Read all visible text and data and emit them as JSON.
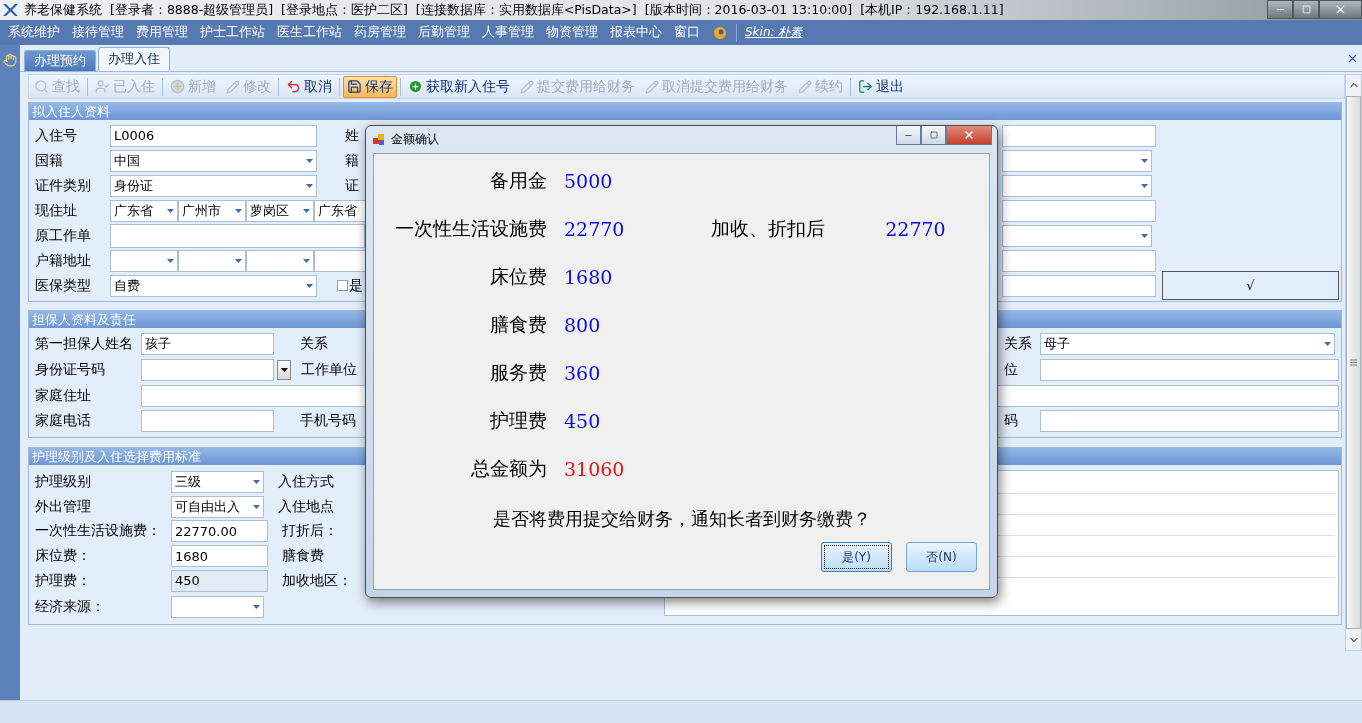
{
  "window": {
    "title": "养老保健系统",
    "info": [
      "[登录者：8888-超级管理员]",
      "[登录地点：医护二区]",
      "[连接数据库：实用数据库<PisData>]",
      "[版本时间：2016-03-01 13:10:00]",
      "[本机IP：192.168.1.11]"
    ]
  },
  "menu": [
    "系统维护",
    "接待管理",
    "费用管理",
    "护士工作站",
    "医生工作站",
    "药房管理",
    "后勤管理",
    "人事管理",
    "物资管理",
    "报表中心",
    "窗口"
  ],
  "skin_link": "Skin: 朴素",
  "tabs": [
    {
      "label": "办理预约",
      "selected": false
    },
    {
      "label": "办理入住",
      "selected": true
    }
  ],
  "toolbar": [
    {
      "kind": "search",
      "label": "查找",
      "disabled": true,
      "highlighted": false
    },
    {
      "kind": "separator"
    },
    {
      "kind": "person",
      "label": "已入住",
      "disabled": true,
      "highlighted": false
    },
    {
      "kind": "separator"
    },
    {
      "kind": "plus",
      "label": "新增",
      "disabled": true,
      "highlighted": false
    },
    {
      "kind": "pencil",
      "label": "修改",
      "disabled": true,
      "highlighted": false
    },
    {
      "kind": "separator"
    },
    {
      "kind": "undo",
      "label": "取消",
      "disabled": false,
      "highlighted": false
    },
    {
      "kind": "separator"
    },
    {
      "kind": "save",
      "label": "保存",
      "disabled": false,
      "highlighted": true
    },
    {
      "kind": "separator"
    },
    {
      "kind": "plus",
      "label": "获取新入住号",
      "disabled": false,
      "highlighted": false
    },
    {
      "kind": "pencil",
      "label": "提交费用给财务",
      "disabled": true,
      "highlighted": false
    },
    {
      "kind": "pencil",
      "label": "取消提交费用给财务",
      "disabled": true,
      "highlighted": false
    },
    {
      "kind": "pencil",
      "label": "续约",
      "disabled": true,
      "highlighted": false
    },
    {
      "kind": "separator"
    },
    {
      "kind": "exit",
      "label": "退出",
      "disabled": false,
      "highlighted": false
    }
  ],
  "resident": {
    "title": "拟入住人资料",
    "rows": [
      {
        "label": "入住号",
        "field": {
          "kind": "text",
          "value": "L0006"
        },
        "side_label": "姓"
      },
      {
        "label": "国籍",
        "field": {
          "kind": "combo",
          "value": "中国"
        },
        "side_label": "籍"
      },
      {
        "label": "证件类别",
        "field": {
          "kind": "combo",
          "value": "身份证"
        },
        "side_label": "证"
      },
      {
        "label": "现住址",
        "field": {
          "kind": "address",
          "parts": [
            {
              "kind": "combo",
              "value": "广东省"
            },
            {
              "kind": "combo",
              "value": "广州市"
            },
            {
              "kind": "combo",
              "value": "萝岗区"
            },
            {
              "kind": "combo",
              "value": "广东省"
            }
          ]
        }
      },
      {
        "label": "原工作单",
        "field": {
          "kind": "wide"
        }
      },
      {
        "label": "户籍地址",
        "field": {
          "kind": "address",
          "parts": [
            {
              "kind": "combo"
            },
            {
              "kind": "combo"
            },
            {
              "kind": "combo"
            },
            {
              "kind": "combo"
            }
          ]
        }
      },
      {
        "label": "医保类型",
        "field": {
          "kind": "combo",
          "value": "自费"
        },
        "checkbox": {
          "label": "是",
          "checked": false
        }
      }
    ],
    "right_fields": [
      {
        "kind": "text"
      },
      {
        "kind": "combo"
      },
      {
        "kind": "combo"
      },
      {
        "kind": "text"
      },
      {
        "kind": "combo"
      },
      {
        "kind": "text"
      },
      {
        "kind": "text"
      }
    ],
    "confirm_button": "√"
  },
  "guarantor": {
    "title": "担保人资料及责任",
    "rows": [
      {
        "label": "第一担保人姓名",
        "field": {
          "kind": "text",
          "value": "孩子"
        },
        "side_label": "关系",
        "right_label": "关系",
        "right_field": {
          "kind": "combo",
          "value": "母子"
        }
      },
      {
        "label": "身份证号码",
        "field": {
          "kind": "text_dropdown"
        },
        "side_label": "工作单位",
        "right_label": "位",
        "right_field": {
          "kind": "text"
        }
      },
      {
        "label": "家庭住址",
        "field": {
          "kind": "full"
        }
      },
      {
        "label": "家庭电话",
        "field": {
          "kind": "text"
        },
        "side_label": "手机号码",
        "right_label": "码",
        "right_field": {
          "kind": "text"
        }
      }
    ]
  },
  "care": {
    "title": "护理级别及入住选择费用标准",
    "rows": [
      {
        "label": "护理级别",
        "field": {
          "kind": "combo",
          "value": "三级"
        },
        "side_label": "入住方式"
      },
      {
        "label": "外出管理",
        "field": {
          "kind": "combo",
          "value": "可自由出入"
        },
        "side_label": "入住地点"
      },
      {
        "label": "一次性生活设施费：",
        "field": {
          "kind": "text",
          "value": "22770.00"
        },
        "side_label": "打折后："
      },
      {
        "label": "床位费：",
        "field": {
          "kind": "text",
          "value": "1680"
        },
        "side_label": "膳食费"
      },
      {
        "label": "护理费：",
        "field": {
          "kind": "text",
          "value": "450",
          "disabled": true
        },
        "side_label": "加收地区："
      },
      {
        "label": "经济来源：",
        "field": {
          "kind": "combo"
        }
      }
    ]
  },
  "dialog": {
    "title": "金额确认",
    "fees": [
      {
        "label": "备用金",
        "value": "5000",
        "color": "#0c0cd8"
      },
      {
        "label": "一次性生活设施费",
        "value": "22770",
        "color": "#0c0cd8",
        "extra": {
          "label": "加收、折扣后",
          "value": "22770"
        }
      },
      {
        "label": "床位费",
        "value": "1680",
        "color": "#0c0cd8"
      },
      {
        "label": "膳食费",
        "value": "800",
        "color": "#0c0cd8"
      },
      {
        "label": "服务费",
        "value": "360",
        "color": "#0c0cd8"
      },
      {
        "label": "护理费",
        "value": "450",
        "color": "#0c0cd8"
      },
      {
        "label": "总金额为",
        "value": "31060",
        "color": "#e01414"
      }
    ],
    "question": "是否将费用提交给财务，通知长者到财务缴费？",
    "buttons": [
      {
        "label": "是(Y)",
        "focused": true
      },
      {
        "label": "否(N)",
        "focused": false
      }
    ]
  }
}
